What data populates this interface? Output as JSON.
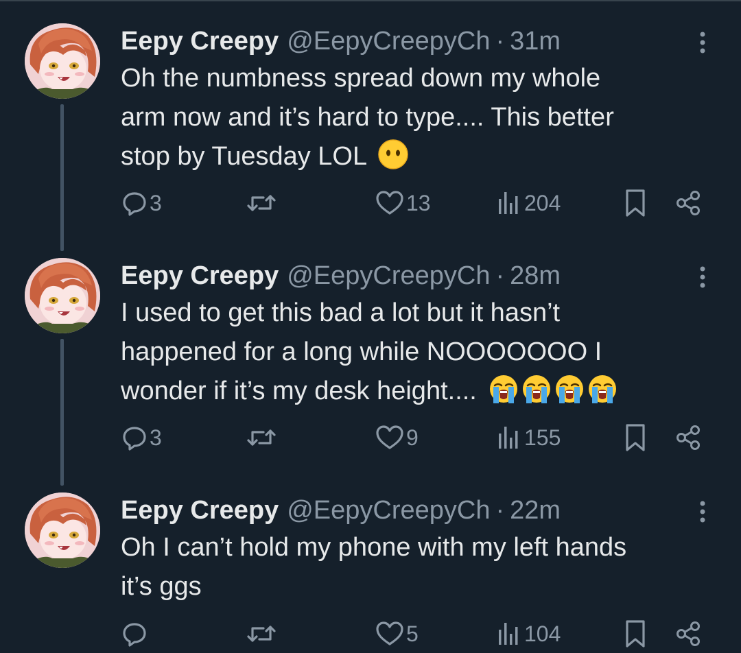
{
  "tweets": [
    {
      "name": "Eepy Creepy",
      "handle": "@EepyCreepyCh",
      "separator": "·",
      "time": "31m",
      "lines": [
        "Oh the numbness spread down my whole",
        "arm now and it’s hard to type.... This better",
        "stop by Tuesday LOL"
      ],
      "emoji": [
        "face-without-mouth"
      ],
      "replies": "3",
      "retweets": "",
      "likes": "13",
      "views": "204"
    },
    {
      "name": "Eepy Creepy",
      "handle": "@EepyCreepyCh",
      "separator": "·",
      "time": "28m",
      "lines": [
        "I used to get this bad a lot but it hasn’t",
        "happened for a long while NOOOOOOO I",
        "wonder if it’s my desk height...."
      ],
      "emoji": [
        "loudly-crying-face",
        "loudly-crying-face",
        "loudly-crying-face",
        "loudly-crying-face"
      ],
      "replies": "3",
      "retweets": "",
      "likes": "9",
      "views": "155"
    },
    {
      "name": "Eepy Creepy",
      "handle": "@EepyCreepyCh",
      "separator": "·",
      "time": "22m",
      "lines": [
        "Oh I can’t hold my phone with my left hands",
        "it’s ggs"
      ],
      "emoji": [],
      "replies": "",
      "retweets": "",
      "likes": "5",
      "views": "104"
    }
  ],
  "icons": {
    "reply": "reply-icon",
    "retweet": "retweet-icon",
    "like": "heart-icon",
    "views": "views-chart-icon",
    "bookmark": "bookmark-icon",
    "share": "share-icon",
    "more": "more-vertical-icon"
  },
  "colors": {
    "background": "#15202b",
    "text": "#e7e9ea",
    "secondary": "#8b98a5",
    "thread_line": "#425364"
  }
}
